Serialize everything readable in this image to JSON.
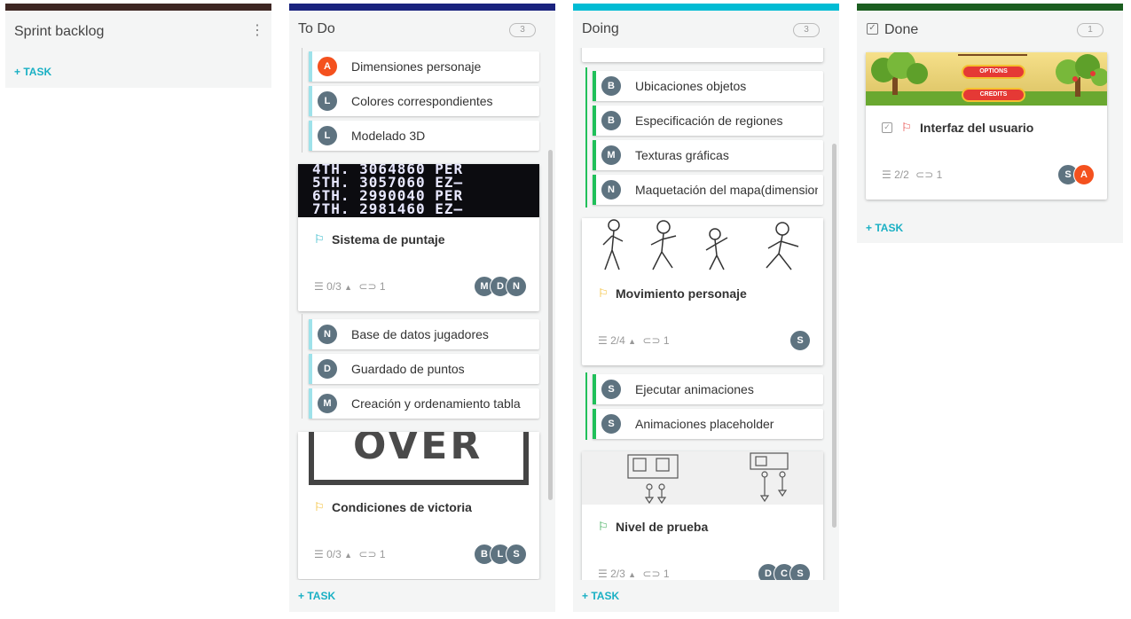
{
  "colors": {
    "slate": "#5e7380",
    "orange": "#f4511e",
    "teal": "#1ab0c4",
    "todo_sub": "#9ee2ea",
    "doing_sub": "#20c05a"
  },
  "columns": {
    "backlog": {
      "title": "Sprint backlog",
      "add": "+ TASK",
      "color": "#3e2723"
    },
    "todo": {
      "title": "To Do",
      "count": "3",
      "add": "+ TASK",
      "color": "#1a237e",
      "subs1": [
        {
          "initial": "A",
          "label": "Dimensiones personaje"
        },
        {
          "initial": "L",
          "label": "Colores correspondientes"
        },
        {
          "initial": "L",
          "label": "Modelado 3D"
        }
      ],
      "card1": {
        "title": "Sistema de puntaje",
        "meta": "0/3",
        "attach": "1",
        "avatars": [
          "M",
          "D",
          "N"
        ],
        "flag_color": "#1ab0c4",
        "score_lines": [
          "4TH.  3064860  PER",
          "5TH.  3057060  EZ–",
          "6TH.  2990040  PER",
          "7TH.  2981460  EZ–"
        ]
      },
      "subs2": [
        {
          "initial": "N",
          "label": "Base de datos jugadores"
        },
        {
          "initial": "D",
          "label": "Guardado de puntos"
        },
        {
          "initial": "M",
          "label": "Creación y ordenamiento tabla"
        }
      ],
      "card2": {
        "title": "Condiciones de victoria",
        "meta": "0/3",
        "attach": "1",
        "avatars": [
          "B",
          "L",
          "S"
        ],
        "flag_color": "#f2b61b",
        "image_text": "OVER"
      }
    },
    "doing": {
      "title": "Doing",
      "count": "3",
      "add": "+ TASK",
      "color": "#00bcd4",
      "subs1": [
        {
          "initial": "B",
          "label": "Ubicaciones objetos"
        },
        {
          "initial": "B",
          "label": "Especificación de regiones"
        },
        {
          "initial": "M",
          "label": "Texturas gráficas"
        },
        {
          "initial": "N",
          "label": "Maquetación del mapa(dimensiones)"
        }
      ],
      "card1": {
        "title": "Movimiento personaje",
        "meta": "2/4",
        "attach": "1",
        "avatars": [
          "S"
        ],
        "flag_color": "#f2b61b"
      },
      "subs2": [
        {
          "initial": "S",
          "label": "Ejecutar animaciones"
        },
        {
          "initial": "S",
          "label": "Animaciones placeholder"
        }
      ],
      "card2": {
        "title": "Nivel de prueba",
        "meta": "2/3",
        "attach": "1",
        "avatars": [
          "D",
          "C",
          "S"
        ],
        "flag_color": "#20a040"
      }
    },
    "done": {
      "title": "Done",
      "count": "1",
      "add": "+ TASK",
      "color": "#1b5e20",
      "card1": {
        "title": "Interfaz del usuario",
        "meta": "2/2",
        "attach": "1",
        "avatars": [
          "S",
          "A"
        ],
        "flag_color": "#e53935",
        "menu_options": "OPTIONS",
        "menu_credits": "CREDITS"
      }
    }
  }
}
